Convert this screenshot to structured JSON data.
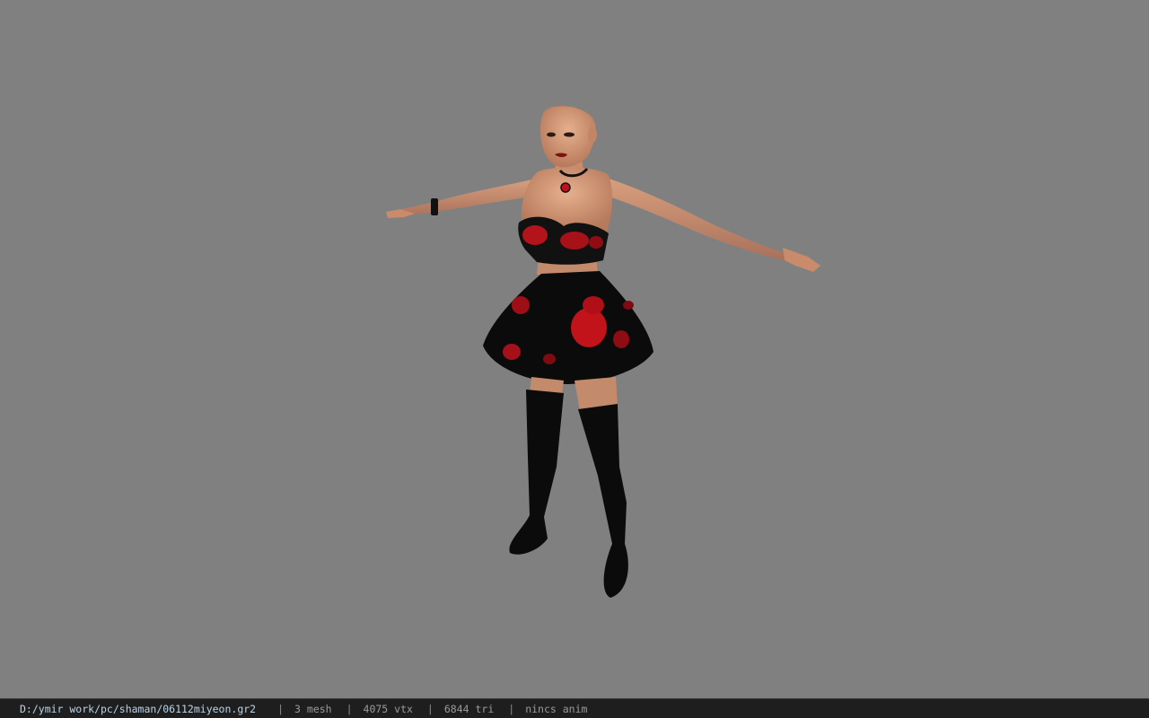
{
  "viewer": {
    "background_color": "#808080",
    "model": {
      "name": "character-model",
      "outfit_colors": {
        "skin": "#d49a78",
        "fabric": "#0c0b0c",
        "rose": "#c2121a"
      }
    }
  },
  "statusbar": {
    "file_path": "D:/ymir work/pc/shaman/06112miyeon.gr2",
    "separator": "|",
    "mesh_count": "3 mesh",
    "vertex_count": "4075 vtx",
    "triangle_count": "6844 tri",
    "anim_status": "nincs anim"
  }
}
